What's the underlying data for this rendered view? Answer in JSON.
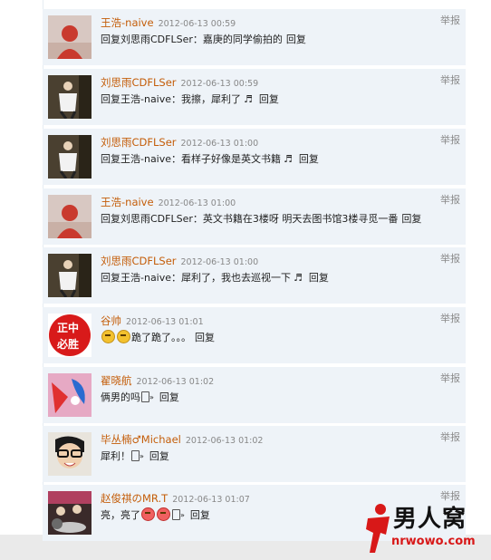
{
  "report_label": "举报",
  "reply_label": "回复",
  "comments": [
    {
      "author": "王浩-naive",
      "time": "2012-06-13 00:59",
      "text": "回复刘思雨CDFLSer：嘉庚的同学偷拍的"
    },
    {
      "author": "刘思雨CDFLSer",
      "time": "2012-06-13 00:59",
      "text": "回复王浩-naive：我擦，犀利了"
    },
    {
      "author": "刘思雨CDFLSer",
      "time": "2012-06-13 01:00",
      "text": "回复王浩-naive：看样子好像是英文书籍"
    },
    {
      "author": "王浩-naive",
      "time": "2012-06-13 01:00",
      "text": "回复刘思雨CDFLSer：英文书籍在3楼呀  明天去图书馆3楼寻觅一番"
    },
    {
      "author": "刘思雨CDFLSer",
      "time": "2012-06-13 01:00",
      "text": "回复王浩-naive：犀利了，我也去巡视一下"
    },
    {
      "author": "谷帅",
      "time": "2012-06-13 01:01",
      "text": "跪了跪了。。。",
      "avatar_text_1": "正中",
      "avatar_text_2": "必胜"
    },
    {
      "author": "翟晓航",
      "time": "2012-06-13 01:02",
      "text": "俩男的吗"
    },
    {
      "author": "毕丛楠♂Michael",
      "time": "2012-06-13 01:02",
      "text": "犀利！"
    },
    {
      "author": "赵俊祺のMR.T",
      "time": "2012-06-13 01:07",
      "text": "亮，亮了"
    }
  ],
  "logo": {
    "title": "男人窝",
    "url": "nrwowo.com"
  },
  "colors": {
    "author": "#c45d09",
    "row_bg": "#eef3f8",
    "logo_red": "#d81818"
  }
}
